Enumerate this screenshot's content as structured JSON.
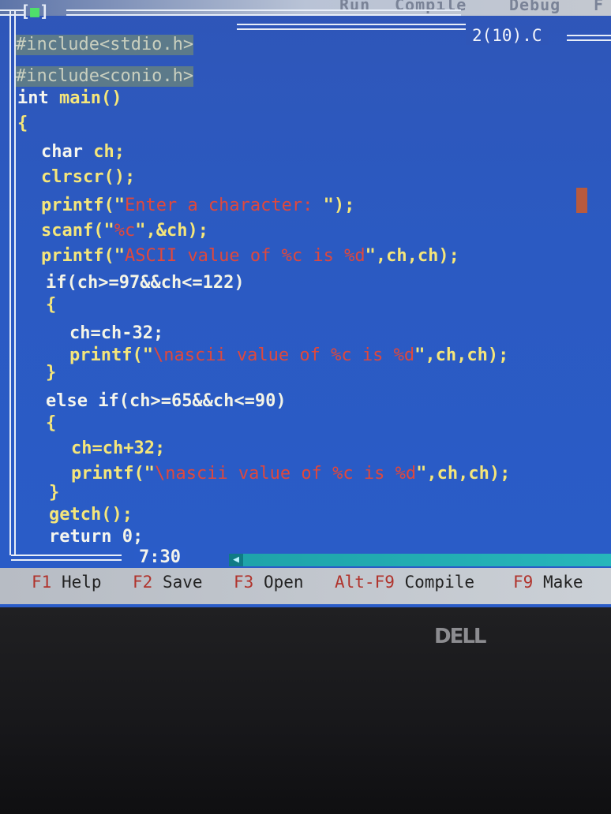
{
  "menubar": {
    "items": [
      "Run",
      "Compile",
      "Debug",
      "F"
    ]
  },
  "window": {
    "close_left": "[",
    "close_box": "■",
    "close_right": "]",
    "title": "2(10).C"
  },
  "code": {
    "include1": "#include<stdio.h>",
    "include2": "#include<conio.h>",
    "main_kw": "int",
    "main_fn": " main()",
    "open_brace": "{",
    "char_kw": "char",
    "char_var": " ch;",
    "clrscr": "clrscr();",
    "printf1_fn": "printf(\"",
    "printf1_str": "Enter a character: ",
    "printf1_end": "\");",
    "scanf_fn": "scanf(\"",
    "scanf_str": "%c",
    "scanf_end": "\",&ch);",
    "printf2_fn": "printf(\"",
    "printf2_str": "ASCII value of %c is %d",
    "printf2_end": "\",ch,ch);",
    "if1": "if(ch>=97&&ch<=122)",
    "brace_open_1": "{",
    "sub": "ch=ch-32;",
    "printf3_fn": "printf(\"",
    "printf3_str": "\\nascii value of %c is %d",
    "printf3_end": "\",ch,ch);",
    "brace_close_1": "}",
    "else_if_kw": "else if",
    "else_if_cond": "(ch>=65&&ch<=90)",
    "brace_open_2": "{",
    "add": "ch=ch+32;",
    "printf4_fn": "printf(\"",
    "printf4_str": "\\nascii value of %c is %d",
    "printf4_end": "\",ch,ch);",
    "brace_close_2": "}",
    "getch": "getch();",
    "return_kw": "return",
    "return_val": " 0;"
  },
  "status": {
    "cursor_position": "7:30"
  },
  "fkeys": [
    {
      "key": "F1",
      "label": " Help"
    },
    {
      "key": "F2",
      "label": " Save"
    },
    {
      "key": "F3",
      "label": " Open"
    },
    {
      "key": "Alt-F9",
      "label": " Compile"
    },
    {
      "key": "F9",
      "label": " Make"
    }
  ],
  "bezel": {
    "brand": "DELL"
  },
  "colors": {
    "screen_bg": "#2b5ac2",
    "string": "#e0483c",
    "function": "#f5e67a",
    "keyword": "#f6f6ee",
    "fkey_bar": "#c4c8cf",
    "fkey_highlight": "#b0332c"
  }
}
